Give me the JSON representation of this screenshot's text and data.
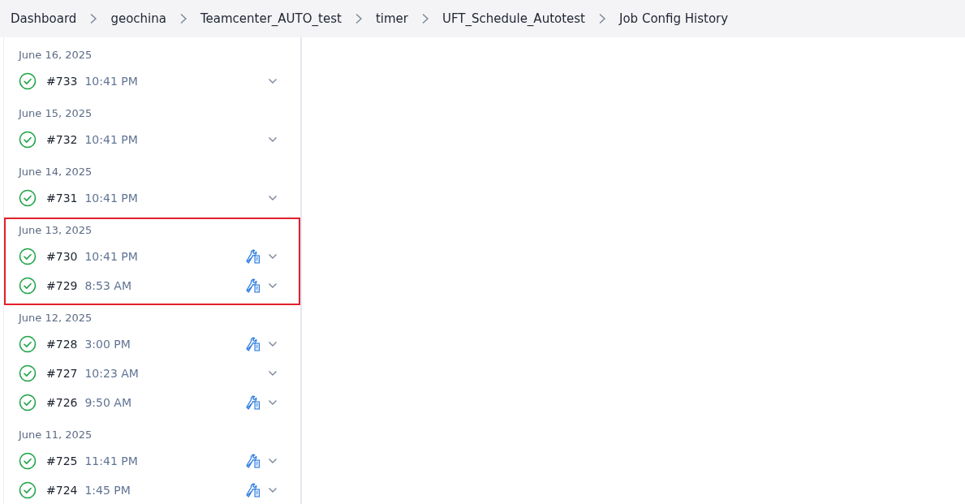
{
  "breadcrumbs": [
    "Dashboard",
    "geochina",
    "Teamcenter_AUTO_test",
    "timer",
    "UFT_Schedule_Autotest",
    "Job Config History"
  ],
  "groups": [
    {
      "date": "June 16, 2025",
      "highlighted": false,
      "builds": [
        {
          "number": "#733",
          "time": "10:41 PM",
          "success": true,
          "config_changed": false
        }
      ]
    },
    {
      "date": "June 15, 2025",
      "highlighted": false,
      "builds": [
        {
          "number": "#732",
          "time": "10:41 PM",
          "success": true,
          "config_changed": false
        }
      ]
    },
    {
      "date": "June 14, 2025",
      "highlighted": false,
      "builds": [
        {
          "number": "#731",
          "time": "10:41 PM",
          "success": true,
          "config_changed": false
        }
      ]
    },
    {
      "date": "June 13, 2025",
      "highlighted": true,
      "builds": [
        {
          "number": "#730",
          "time": "10:41 PM",
          "success": true,
          "config_changed": true
        },
        {
          "number": "#729",
          "time": "8:53 AM",
          "success": true,
          "config_changed": true
        }
      ]
    },
    {
      "date": "June 12, 2025",
      "highlighted": false,
      "builds": [
        {
          "number": "#728",
          "time": "3:00 PM",
          "success": true,
          "config_changed": true
        },
        {
          "number": "#727",
          "time": "10:23 AM",
          "success": true,
          "config_changed": false
        },
        {
          "number": "#726",
          "time": "9:50 AM",
          "success": true,
          "config_changed": true
        }
      ]
    },
    {
      "date": "June 11, 2025",
      "highlighted": false,
      "builds": [
        {
          "number": "#725",
          "time": "11:41 PM",
          "success": true,
          "config_changed": true
        },
        {
          "number": "#724",
          "time": "1:45 PM",
          "success": true,
          "config_changed": true
        }
      ]
    }
  ]
}
